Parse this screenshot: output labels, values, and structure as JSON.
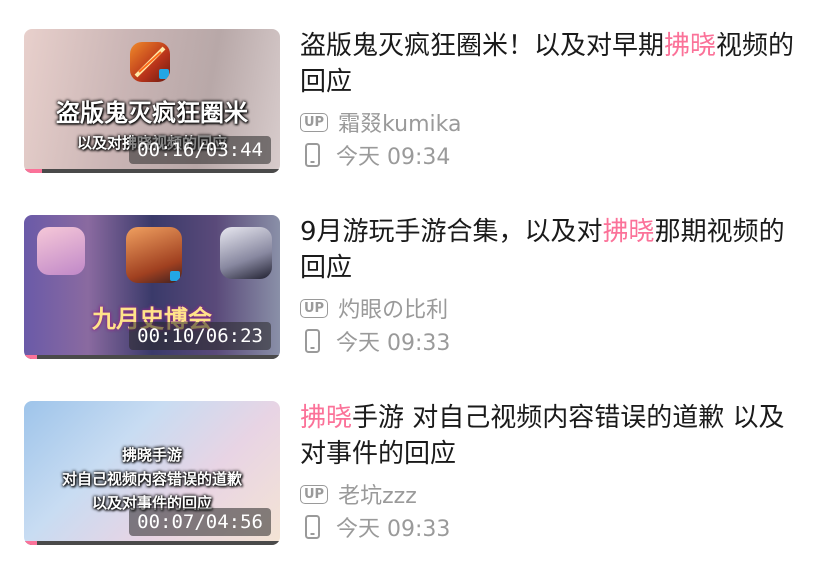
{
  "colors": {
    "accent": "#fb7299",
    "meta": "#9a9a9a"
  },
  "videos": [
    {
      "title_before": "盗版鬼灭疯狂圈米！以及对早期",
      "title_highlight": "拂晓",
      "title_after": "视频的回应",
      "uploader": "霜叕kumika",
      "up_badge": "UP",
      "time": "今天 09:34",
      "duration": "00:16/03:44",
      "progress": 0.07,
      "thumb_text": [
        "盗版鬼灭疯狂圈米",
        "以及对拂晓视频的回应"
      ],
      "thumb_icon": "game-app-icon"
    },
    {
      "title_before": "9月游玩手游合集，以及对",
      "title_highlight": "拂晓",
      "title_after": "那期视频的回应",
      "uploader": "灼眼の比利",
      "up_badge": "UP",
      "time": "今天 09:33",
      "duration": "00:10/06:23",
      "progress": 0.05,
      "thumb_text": [
        "九月史博会"
      ],
      "thumb_icon": "game-app-icons"
    },
    {
      "title_before": "",
      "title_highlight": "拂晓",
      "title_after": "手游 对自己视频内容错误的道歉 以及对事件的回应",
      "uploader": "老坑zzz",
      "up_badge": "UP",
      "time": "今天 09:33",
      "duration": "00:07/04:56",
      "progress": 0.05,
      "thumb_text": [
        "拂晓手游",
        "对自己视频内容错误的道歉",
        "以及对事件的回应"
      ],
      "thumb_icon": ""
    }
  ]
}
